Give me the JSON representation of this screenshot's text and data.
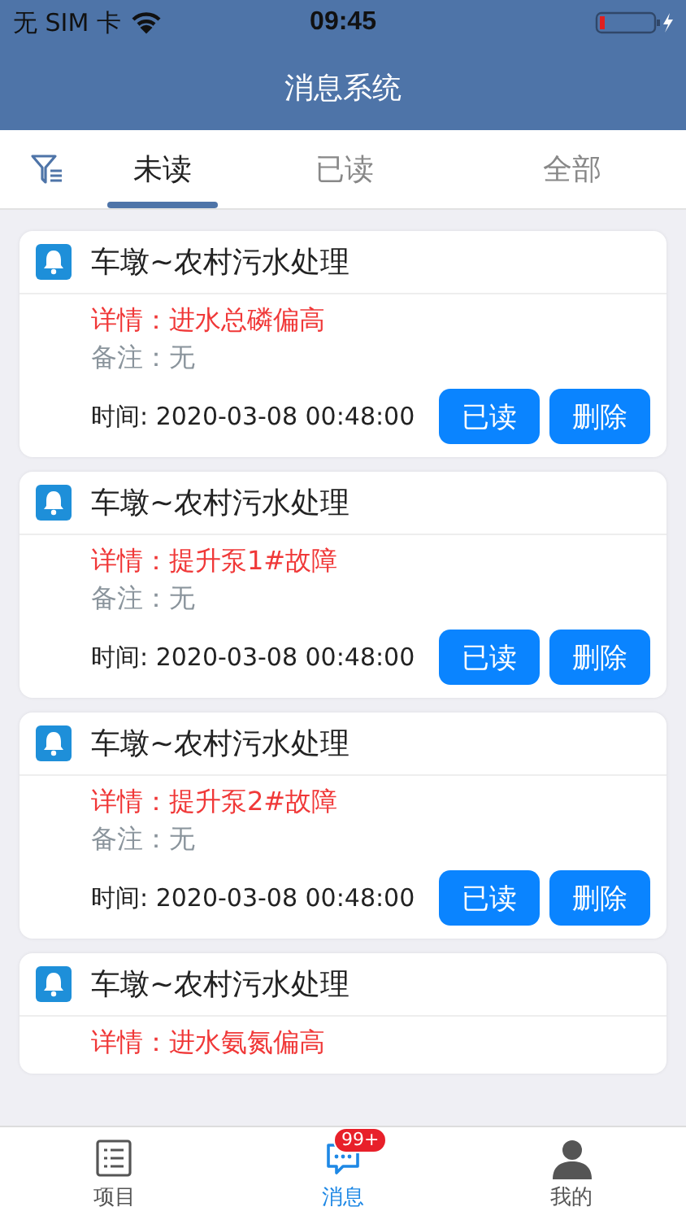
{
  "status_bar": {
    "carrier": "无 SIM 卡",
    "time": "09:45"
  },
  "header": {
    "title": "消息系统"
  },
  "tabs": [
    {
      "label": "未读",
      "selected": true
    },
    {
      "label": "已读",
      "selected": false
    },
    {
      "label": "全部",
      "selected": false
    }
  ],
  "messages": [
    {
      "title": "车墩~农村污水处理",
      "detail": "详情：进水总磷偏高",
      "remark": "备注：无",
      "time": "时间: 2020-03-08 00:48:00",
      "actions": [
        "已读",
        "删除"
      ]
    },
    {
      "title": "车墩~农村污水处理",
      "detail": "详情：提升泵1#故障",
      "remark": "备注：无",
      "time": "时间: 2020-03-08 00:48:00",
      "actions": [
        "已读",
        "删除"
      ]
    },
    {
      "title": "车墩~农村污水处理",
      "detail": "详情：提升泵2#故障",
      "remark": "备注：无",
      "time": "时间: 2020-03-08 00:48:00",
      "actions": [
        "已读",
        "删除"
      ]
    },
    {
      "title": "车墩~农村污水处理",
      "detail": "详情：进水氨氮偏高"
    }
  ],
  "tab_bar": [
    {
      "kind": "list",
      "label": "项目",
      "selected": false
    },
    {
      "kind": "chat",
      "label": "消息",
      "selected": true,
      "badge": "99+"
    },
    {
      "kind": "person",
      "label": "我的",
      "selected": false
    }
  ]
}
